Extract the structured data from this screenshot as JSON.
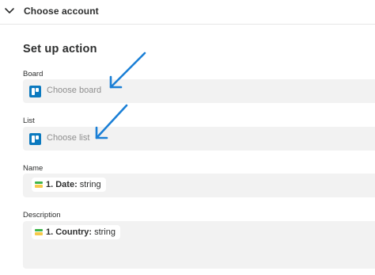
{
  "header": {
    "title": "Choose account"
  },
  "section": {
    "title": "Set up action"
  },
  "fields": {
    "board": {
      "label": "Board",
      "placeholder": "Choose board",
      "app_icon": "trello-icon"
    },
    "list": {
      "label": "List",
      "placeholder": "Choose list",
      "app_icon": "trello-icon"
    },
    "name": {
      "label": "Name",
      "pill_prefix": "1. Date:",
      "pill_type": "string",
      "pill_icon": "google-sheets-icon"
    },
    "description": {
      "label": "Description",
      "pill_prefix": "1. Country:",
      "pill_type": "string",
      "pill_icon": "google-sheets-icon"
    }
  },
  "annotations": {
    "arrow_color": "#1a7fd6"
  },
  "colors": {
    "field_background": "#f2f2f2",
    "text": "#2d2e2e",
    "placeholder": "#8f8f8f",
    "trello_blue": "#0a79bf"
  }
}
